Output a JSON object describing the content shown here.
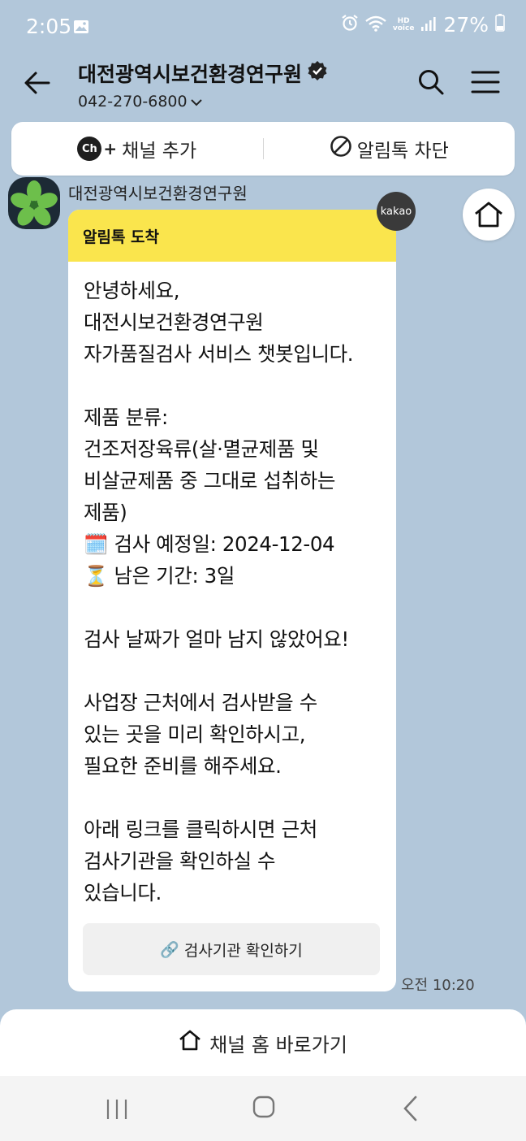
{
  "status_bar": {
    "time": "2:05",
    "hd_top": "HD",
    "hd_bottom": "voice",
    "battery": "27%"
  },
  "header": {
    "title": "대전광역시보건환경연구원",
    "phone": "042-270-6800"
  },
  "actions": {
    "add_channel": "채널 추가",
    "block_alimtalk": "알림톡 차단",
    "ch_badge": "Ch"
  },
  "message": {
    "sender": "대전광역시보건환경연구원",
    "header": "알림톡 도착",
    "body": "안녕하세요,\n대전시보건환경연구원\n자가품질검사 서비스 챗봇입니다.\n\n제품 분류:\n건조저장육류(살·멸균제품 및\n비살균제품 중 그대로 섭취하는\n제품)\n🗓️ 검사 예정일: 2024-12-04\n⏳ 남은 기간: 3일\n\n검사 날짜가 얼마 남지 않았어요!\n\n사업장 근처에서 검사받을 수\n있는 곳을 미리 확인하시고,\n필요한 준비를 해주세요.\n\n아래 링크를 클릭하시면 근처\n검사기관을 확인하실 수\n있습니다.",
    "link_icon": "🔗",
    "link_label": "검사기관 확인하기",
    "time": "오전 10:20",
    "kakao_badge": "kakao"
  },
  "bottom": {
    "channel_home": "채널 홈 바로가기"
  }
}
